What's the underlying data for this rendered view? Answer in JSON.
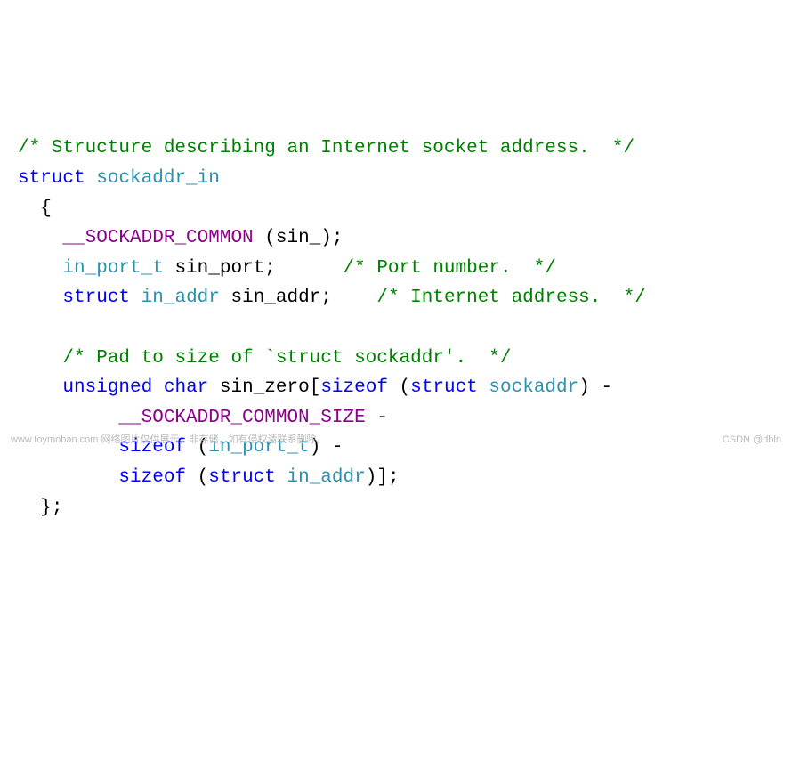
{
  "code": {
    "comment_top": "/* Structure describing an Internet socket address.  */",
    "kw_struct": "struct",
    "type_sockaddr_in": "sockaddr_in",
    "brace_open": "{",
    "macro_sockaddr_common": "__SOCKADDR_COMMON",
    "sockaddr_common_args": " (sin_);",
    "type_in_port_t": "in_port_t",
    "ident_sin_port": "sin_port",
    "semi": ";",
    "comment_port": "/* Port number.  */",
    "type_in_addr": "in_addr",
    "ident_sin_addr": "sin_addr",
    "comment_addr": "/* Internet address.  */",
    "comment_pad": "/* Pad to size of `struct sockaddr'.  */",
    "kw_unsigned": "unsigned",
    "kw_char": "char",
    "ident_sin_zero": "sin_zero",
    "bracket_open": "[",
    "kw_sizeof": "sizeof",
    "paren_open": " (",
    "type_sockaddr": "sockaddr",
    "paren_close": ")",
    "minus": " -",
    "macro_common_size": "__SOCKADDR_COMMON_SIZE",
    "bracket_close": "]",
    "brace_close": "};"
  },
  "watermark": {
    "left": "www.toymoban.com 网络图片仅供展示，非存储，如有侵权请联系删除。",
    "right": "CSDN @dbln"
  }
}
